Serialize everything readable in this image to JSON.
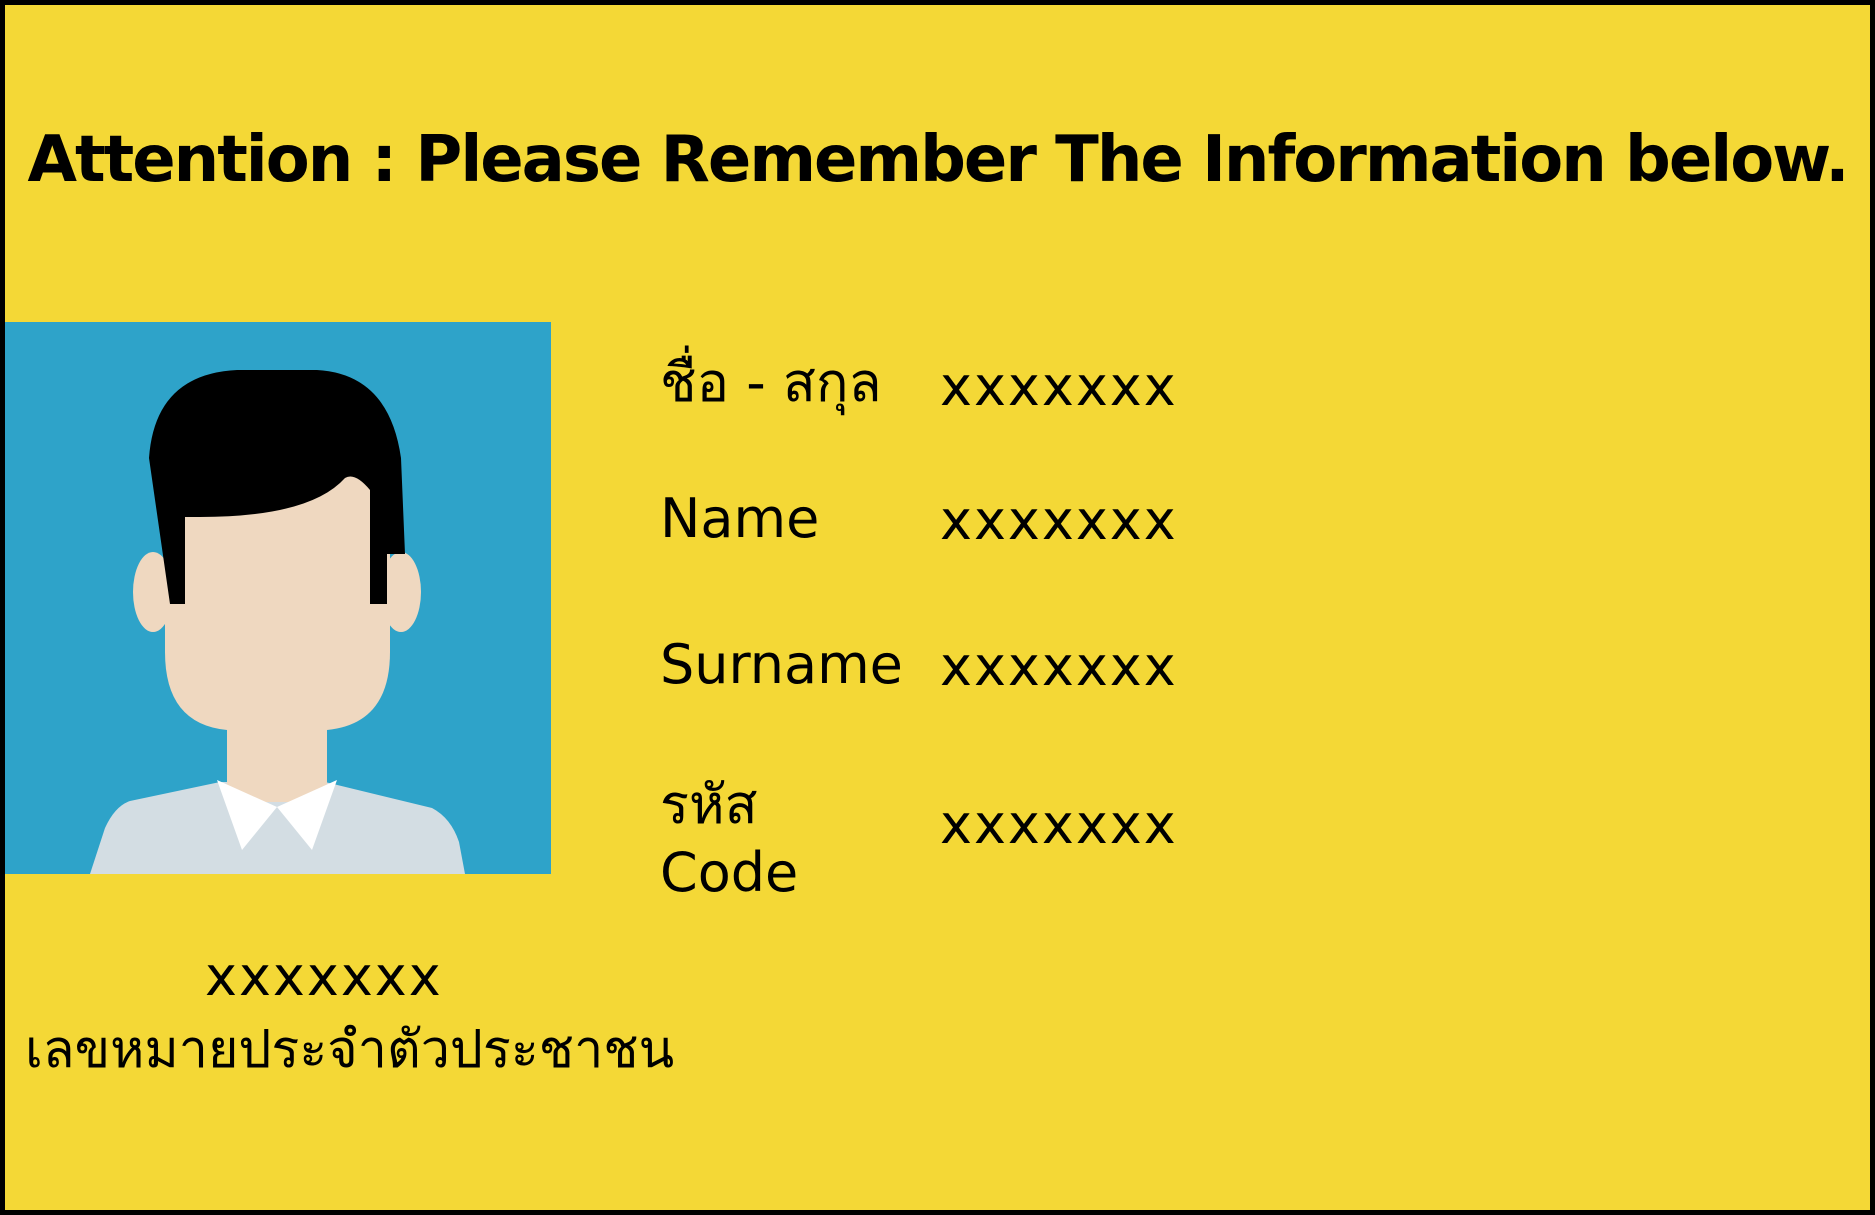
{
  "title": "Attention : Please Remember The Information below.",
  "colors": {
    "background": "#f4d836",
    "border": "#000000",
    "photo_background": "#2ea3c9",
    "hair": "#000000",
    "skin": "#efd8c0",
    "shirt": "#d3dde3",
    "collar": "#ffffff"
  },
  "photo": {
    "icon": "person-avatar-icon"
  },
  "fields": [
    {
      "label": "ชื่อ - สกุล",
      "value": "xxxxxxx"
    },
    {
      "label": "Name",
      "value": "xxxxxxx"
    },
    {
      "label": "Surname",
      "value": "xxxxxxx"
    },
    {
      "label_line1": "รหัส",
      "label_line2": "Code",
      "value": "xxxxxxx"
    }
  ],
  "id_card": {
    "value": "xxxxxxx",
    "label": "เลขหมายประจำตัวประชาชน"
  }
}
